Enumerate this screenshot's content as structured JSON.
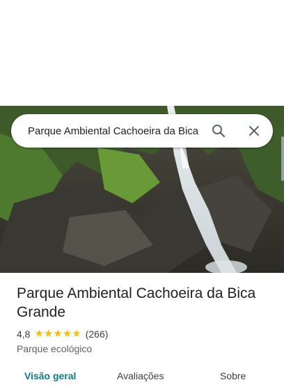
{
  "search": {
    "query": "Parque Ambiental Cachoeira da Bica"
  },
  "place": {
    "title": "Parque Ambiental Cachoeira da Bica Grande",
    "rating": "4,8",
    "stars_filled": 5,
    "review_count": "(266)",
    "category": "Parque ecológico"
  },
  "tabs": [
    {
      "label": "Visão geral",
      "active": true
    },
    {
      "label": "Avaliações",
      "active": false
    },
    {
      "label": "Sobre",
      "active": false
    }
  ],
  "colors": {
    "accent": "#0b7c86",
    "star": "#fbbc04"
  },
  "icons": {
    "search": "search-icon",
    "close": "close-icon",
    "star": "star-icon"
  }
}
